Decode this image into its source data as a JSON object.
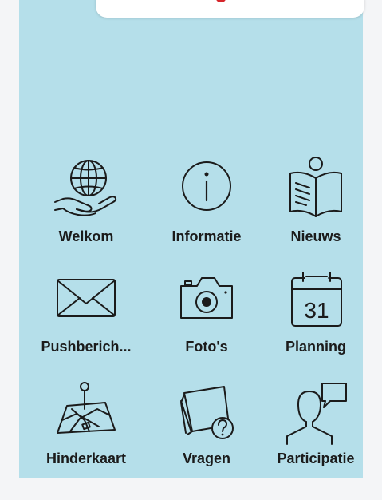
{
  "tiles": [
    {
      "label": "Welkom",
      "icon": "globe-hand-icon"
    },
    {
      "label": "Informatie",
      "icon": "info-icon"
    },
    {
      "label": "Nieuws",
      "icon": "news-reader-icon"
    },
    {
      "label": "Pushberich...",
      "icon": "envelope-icon"
    },
    {
      "label": "Foto's",
      "icon": "camera-icon"
    },
    {
      "label": "Planning",
      "icon": "calendar-icon"
    },
    {
      "label": "Hinderkaart",
      "icon": "map-pin-icon"
    },
    {
      "label": "Vragen",
      "icon": "question-notes-icon"
    },
    {
      "label": "Participatie",
      "icon": "speech-person-icon"
    }
  ],
  "calendar_day": "31",
  "colors": {
    "panel_bg": "#b5dfea",
    "icon_stroke": "#1b1b1b",
    "logo_red": "#d6262b",
    "logo_blue": "#2a4ea0"
  }
}
